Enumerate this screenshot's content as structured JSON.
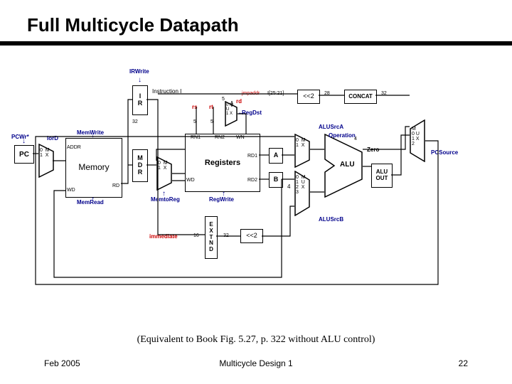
{
  "title": "Full Multicycle Datapath",
  "caption": "(Equivalent to Book Fig. 5.27, p. 322 without ALU control)",
  "footer": {
    "left": "Feb 2005",
    "center": "Multicycle Design 1",
    "right": "22"
  },
  "blocks": {
    "pc": "PC",
    "memory": "Memory",
    "ir": "I\nR",
    "mdr": "M\nD\nR",
    "registers": "Registers",
    "a": "A",
    "b": "B",
    "alu": "ALU",
    "aluout": "ALU\nOUT",
    "concat": "CONCAT",
    "extnd": "E\nX\nT\nN\nD",
    "sl2a": "<<2",
    "sl2b": "<<2",
    "mux01a": "0  M\n1  X",
    "mux01b": "0  M\n1  X",
    "mux01c": "0 M\nU\n1 X",
    "mux01d": "0  M\n1  X",
    "mux4": "0  M\n1  U\n2  X\n3",
    "mux3": "M\n0 U\n1 X\n2"
  },
  "ports": {
    "addr": "ADDR",
    "rd": "RD",
    "wd": "WD",
    "rn1": "RN1",
    "rn2": "RN2",
    "wn": "WN",
    "rd1": "RD1",
    "rd2": "RD2",
    "instr": "Instruction  I",
    "rs": "rs",
    "rt": "rt",
    "rd_field": "rd",
    "i2521": "I[25:21]",
    "zero": "Zero",
    "four": "4"
  },
  "widths": {
    "w5": "5",
    "w16": "16",
    "w28": "28",
    "w32": "32",
    "w4": "4"
  },
  "signals": {
    "irwrite": "IRWrite",
    "pcwrite": "PCWr*",
    "iord": "IorD",
    "memwrite": "MemWrite",
    "memread": "MemRead",
    "memtoreg": "MemtoReg",
    "regdst": "RegDst",
    "regwrite": "RegWrite",
    "alusrca": "ALUSrcA",
    "operation": "Operation",
    "alusrcb": "ALUSrcB",
    "pcsource": "PCSource",
    "jmpaddr": "jmpaddr",
    "immediate": "immediate"
  }
}
